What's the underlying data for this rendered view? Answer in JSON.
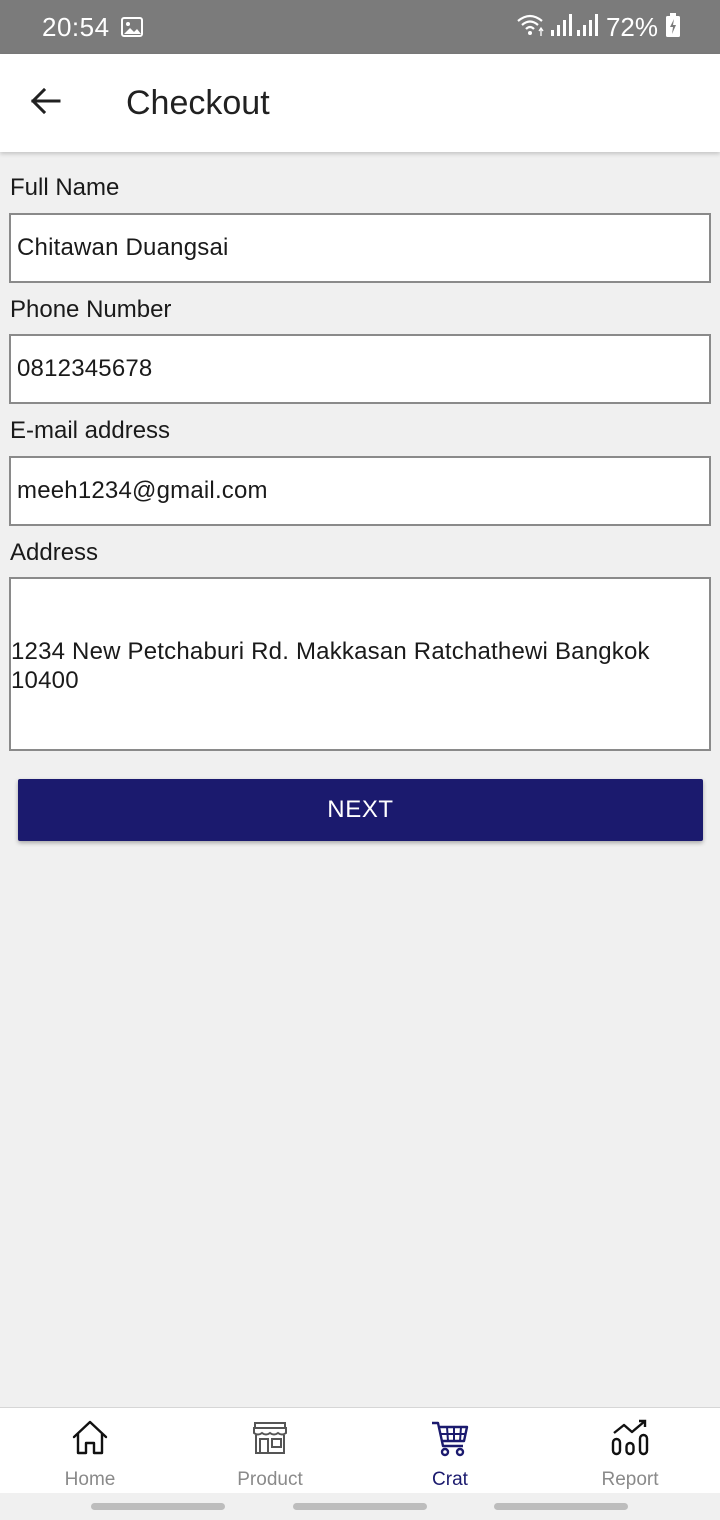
{
  "status_bar": {
    "time": "20:54",
    "battery": "72%",
    "icons": [
      "gallery-icon",
      "wifi-icon",
      "signal-icon",
      "signal-icon",
      "battery-charging-icon"
    ]
  },
  "app_bar": {
    "title": "Checkout",
    "back_icon": "arrow-left-icon"
  },
  "form": {
    "full_name": {
      "label": "Full Name",
      "value": "Chitawan Duangsai"
    },
    "phone": {
      "label": "Phone Number",
      "value": "0812345678"
    },
    "email": {
      "label": "E-mail address",
      "value": "meeh1234@gmail.com"
    },
    "address": {
      "label": "Address",
      "value": " 1234 New Petchaburi Rd. Makkasan Ratchathewi Bangkok 10400"
    },
    "next_label": "NEXT"
  },
  "bottom_nav": {
    "items": [
      {
        "label": "Home",
        "icon": "home-icon",
        "active": false
      },
      {
        "label": "Product",
        "icon": "store-icon",
        "active": false
      },
      {
        "label": "Crat",
        "icon": "cart-icon",
        "active": true
      },
      {
        "label": "Report",
        "icon": "chart-icon",
        "active": false
      }
    ]
  },
  "colors": {
    "status_bar": "#7b7b7b",
    "background": "#f0f0f0",
    "primary": "#1b1a6e",
    "inactive_nav": "#8a8a8a",
    "field_border": "#8a8a8a"
  }
}
